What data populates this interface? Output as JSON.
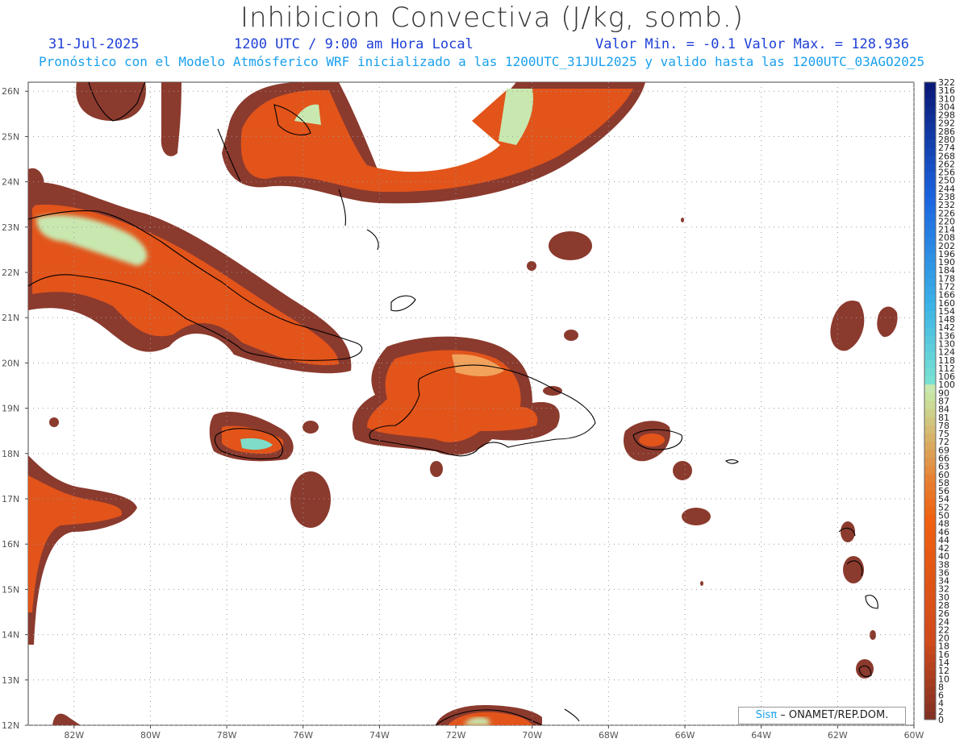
{
  "header": {
    "title": "Inhibicion Convectiva (J/kg, somb.)",
    "date": "31-Jul-2025",
    "time": "1200 UTC / 9:00 am Hora Local",
    "minmax": "Valor Min. = -0.1  Valor Max. = 128.936",
    "forecast": "Pronóstico con el Modelo Atmósferico WRF inicializado a las 1200UTC_31JUL2025 y valido hasta las  1200UTC_03AGO2025"
  },
  "credit": {
    "brand": "Sisπ",
    "text": " – ONAMET/REP.DOM."
  },
  "map": {
    "lon_range": [
      -83.2,
      -60
    ],
    "lat_range": [
      12,
      26.2
    ],
    "lon_ticks": [
      "82W",
      "80W",
      "78W",
      "76W",
      "74W",
      "72W",
      "70W",
      "68W",
      "66W",
      "64W",
      "62W",
      "60W"
    ],
    "lat_ticks": [
      "12N",
      "13N",
      "14N",
      "15N",
      "16N",
      "17N",
      "18N",
      "19N",
      "20N",
      "21N",
      "22N",
      "23N",
      "24N",
      "25N",
      "26N"
    ],
    "colors": {
      "low": "#8b3a2e",
      "mid": "#e2541a",
      "high": "#f2a25a",
      "peak": "#c8e8b0",
      "coast": "#000000",
      "grid": "#9a9a9a"
    }
  },
  "colorbar": {
    "labels": [
      "322",
      "316",
      "310",
      "304",
      "298",
      "292",
      "286",
      "280",
      "274",
      "268",
      "262",
      "256",
      "250",
      "244",
      "238",
      "232",
      "226",
      "220",
      "214",
      "208",
      "202",
      "196",
      "190",
      "184",
      "178",
      "172",
      "166",
      "160",
      "154",
      "148",
      "142",
      "136",
      "130",
      "124",
      "118",
      "112",
      "106",
      "100",
      "90",
      "87",
      "84",
      "81",
      "78",
      "75",
      "72",
      "69",
      "66",
      "63",
      "60",
      "58",
      "56",
      "54",
      "52",
      "50",
      "48",
      "46",
      "44",
      "42",
      "40",
      "38",
      "36",
      "34",
      "32",
      "30",
      "28",
      "26",
      "24",
      "22",
      "20",
      "18",
      "16",
      "14",
      "12",
      "10",
      "8",
      "6",
      "4",
      "2",
      "0"
    ]
  }
}
